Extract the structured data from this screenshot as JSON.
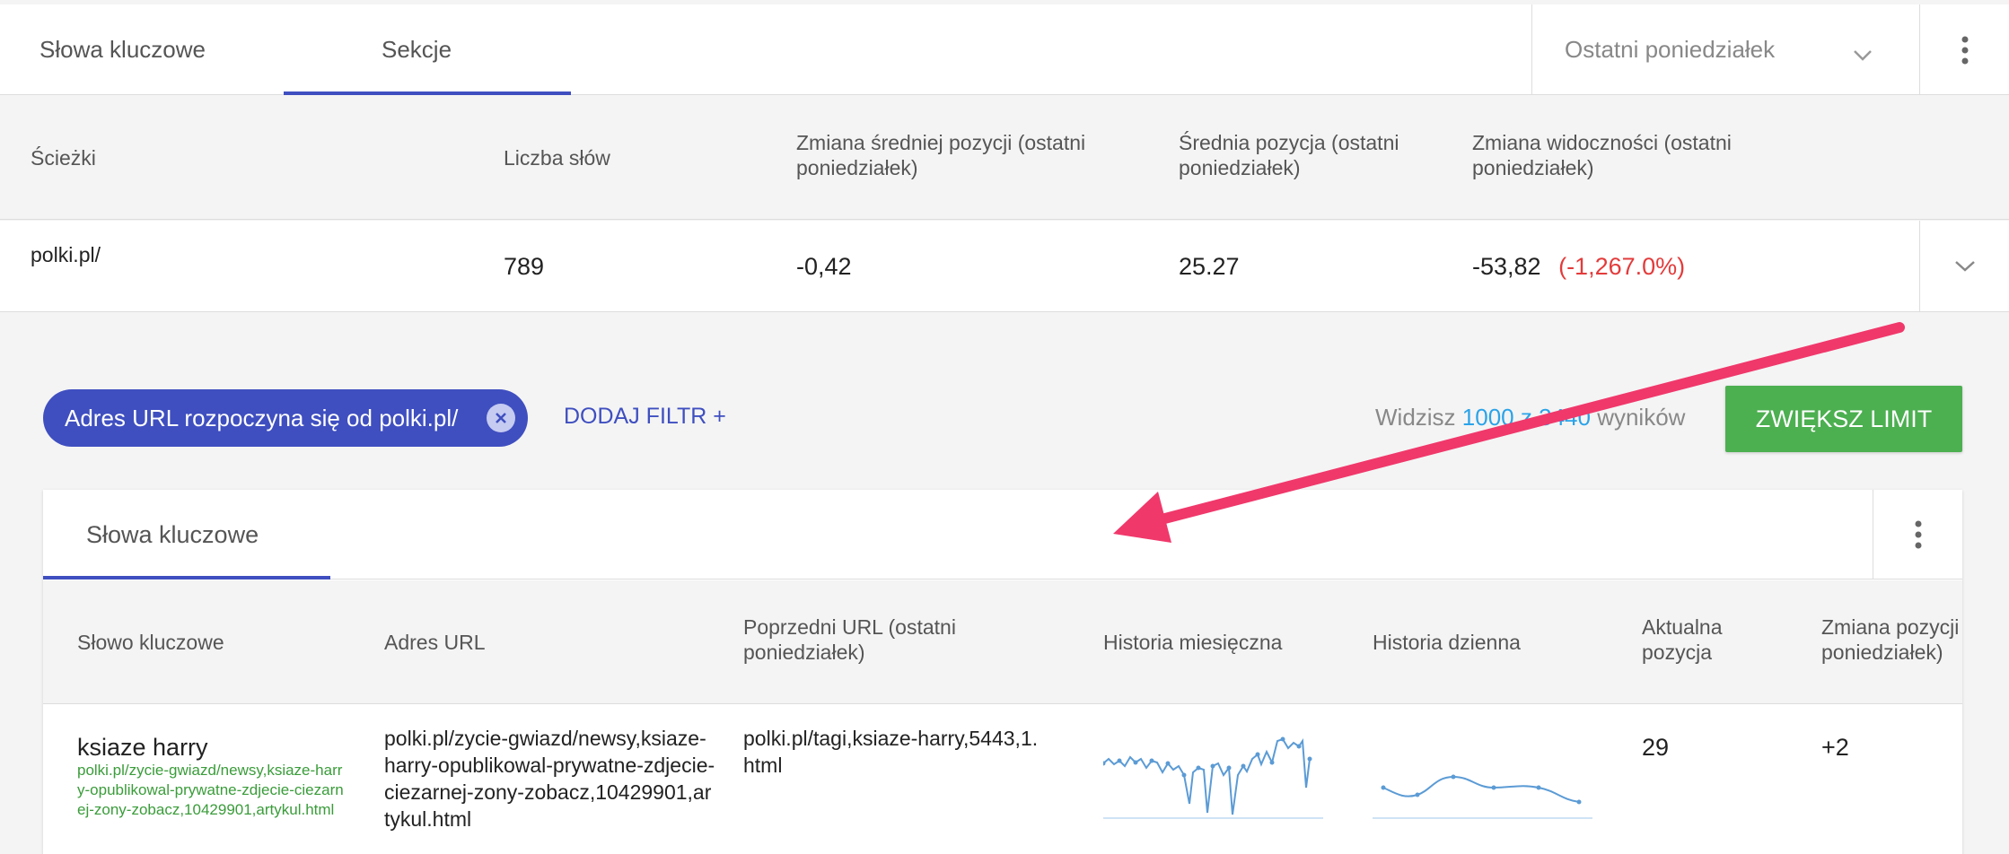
{
  "top_tabs": {
    "tab1": "Słowa kluczowe",
    "tab2": "Sekcje",
    "date_select": "Ostatni poniedziałek"
  },
  "summary": {
    "headers": {
      "paths": "Ścieżki",
      "word_count": "Liczba słów",
      "avg_pos_change": "Zmiana średniej pozycji (ostatni poniedziałek)",
      "avg_pos": "Średnia pozycja (ostatni poniedziałek)",
      "visibility_change": "Zmiana widoczności (ostatni poniedziałek)"
    },
    "row": {
      "path": "polki.pl/",
      "word_count": "789",
      "avg_pos_change": "-0,42",
      "avg_pos": "25.27",
      "visibility_change": "-53,82",
      "visibility_change_pct": "(-1,267.0%)"
    }
  },
  "filters": {
    "chip_label": "Adres URL rozpoczyna się od polki.pl/",
    "add_filter": "DODAJ FILTR",
    "add_filter_plus": "+",
    "results_prefix": "Widzisz",
    "results_shown": "1000",
    "results_sep": "z",
    "results_total": "3440",
    "results_suffix": "wyników",
    "limit_button": "ZWIĘKSZ LIMIT"
  },
  "keywords_card": {
    "tab": "Słowa kluczowe",
    "headers": {
      "keyword": "Słowo kluczowe",
      "url": "Adres URL",
      "prev_url": "Poprzedni URL (ostatni poniedziałek)",
      "monthly_history": "Historia miesięczna",
      "daily_history": "Historia dzienna",
      "current_position": "Aktualna pozycja",
      "position_change": "Zmiana pozycji (ostatni poniedziałek)"
    },
    "rows": [
      {
        "keyword": "ksiaze harry",
        "keyword_url": "polki.pl/zycie-gwiazd/newsy,ksiaze-harry-opublikowal-prywatne-zdjecie-ciezarnej-zony-zobacz,10429901,artykul.html",
        "url": "polki.pl/zycie-gwiazd/newsy,ksiaze-harry-opublikowal-prywatne-zdjecie-ciezarnej-zony-zobacz,10429901,artykul.html",
        "prev_url": "polki.pl/tagi,ksiaze-harry,5443,1.html",
        "current_position": "29",
        "position_change": "+2"
      }
    ]
  },
  "colors": {
    "accent": "#3f4fc0",
    "green": "#4caf50",
    "negative": "#e33b3b",
    "link_blue": "#2aa3e8",
    "arrow": "#f0386b"
  }
}
